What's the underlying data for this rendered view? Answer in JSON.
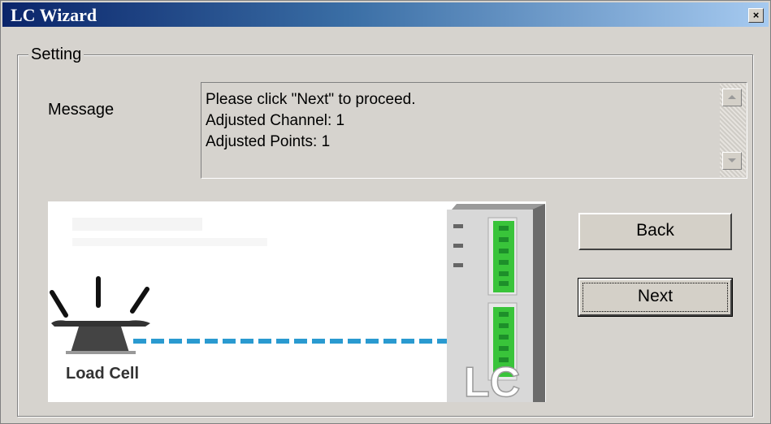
{
  "window": {
    "title": "LC Wizard",
    "close_glyph": "×"
  },
  "group": {
    "label": "Setting"
  },
  "message": {
    "label": "Message",
    "lines": [
      "Please click \"Next\" to proceed.",
      "Adjusted Channel: 1",
      "Adjusted Points: 1"
    ]
  },
  "illustration": {
    "load_cell_label": "Load Cell",
    "module_label": "LC",
    "accent_color": "#2a9ad0",
    "terminal_color": "#39c43a"
  },
  "buttons": {
    "back": "Back",
    "next": "Next"
  }
}
